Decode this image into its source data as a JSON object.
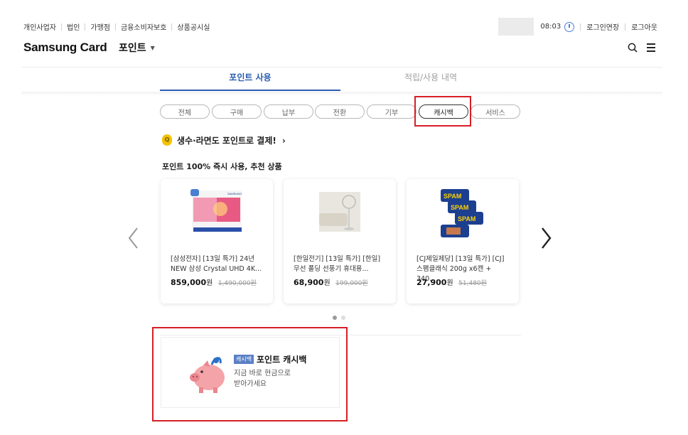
{
  "utility_nav": {
    "left_links": [
      "개인사업자",
      "법인",
      "가맹점",
      "금융소비자보호",
      "상품공시실"
    ],
    "session_time": "08:03",
    "extend_login": "로그인연장",
    "logout": "로그아웃"
  },
  "header": {
    "brand": "Samsung Card",
    "section": "포인트"
  },
  "main_tabs": {
    "use": "포인트 사용",
    "history": "적립/사용 내역"
  },
  "filters": [
    "전체",
    "구매",
    "납부",
    "전환",
    "기부",
    "캐시백",
    "서비스"
  ],
  "selected_filter": "캐시백",
  "promo": {
    "text": "생수·라면도 포인트로 결제!",
    "chevron": "›"
  },
  "recommend": {
    "title": "포인트 100% 즉시 사용, 추천 상품",
    "products": [
      {
        "name_line1": "[삼성전자] [13일 특가] 24년",
        "name_line2": "NEW 삼성 Crystal UHD 4K...",
        "price": "859,000",
        "won": "원",
        "original": "1,490,000원"
      },
      {
        "name_line1": "[한일전기] [13일 특가] [한일]",
        "name_line2": "무선 폴딩 선풍기 휴대용...",
        "price": "68,900",
        "won": "원",
        "original": "199,000원"
      },
      {
        "name_line1": "[CJ제일제당] [13일 특가] [CJ]",
        "name_line2": "스팸클래식 200g x6캔 + 340...",
        "price": "27,900",
        "won": "원",
        "original": "51,480원"
      }
    ],
    "tv_brand_text": "SAMSUNG",
    "spam_label": "SPAM"
  },
  "carousel": {
    "page": 1,
    "total": 2
  },
  "cashback": {
    "badge": "캐시백",
    "title": "포인트 캐시백",
    "desc_line1": "지금 바로 현금으로",
    "desc_line2": "받아가세요"
  },
  "colors": {
    "accent": "#2a5db0",
    "highlight": "#d61f26",
    "badge": "#5a7fc4",
    "promo_icon": "#f3c300"
  }
}
